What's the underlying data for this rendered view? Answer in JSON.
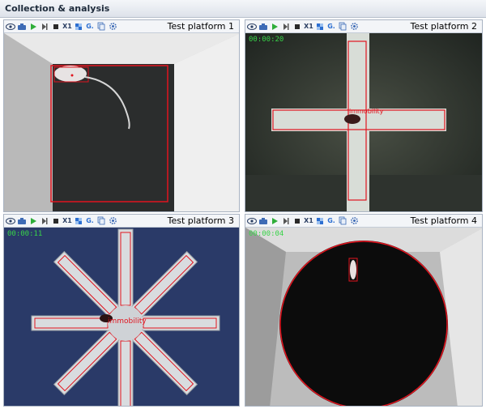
{
  "window": {
    "title": "Collection & analysis"
  },
  "colors": {
    "tracking": "#e1141e",
    "timer": "#38d448",
    "panel_border": "#a9b3c2"
  },
  "toolbar_icons": [
    "eye-icon",
    "camera-icon",
    "play-icon",
    "step-icon",
    "stop-icon",
    "speed-x1-icon",
    "grid-icon",
    "zoom-icon",
    "copy-icon",
    "settings-icon"
  ],
  "toolbar_labels": {
    "speed": "X1",
    "zoom": "G."
  },
  "panels": [
    {
      "title": "Test platform 1",
      "timer": "",
      "overlay_label": ""
    },
    {
      "title": "Test platform 2",
      "timer": "00:00:20",
      "overlay_label": "immobility"
    },
    {
      "title": "Test platform 3",
      "timer": "00:00:11",
      "overlay_label": "immobility"
    },
    {
      "title": "Test platform 4",
      "timer": "00:00:04",
      "overlay_label": ""
    }
  ]
}
